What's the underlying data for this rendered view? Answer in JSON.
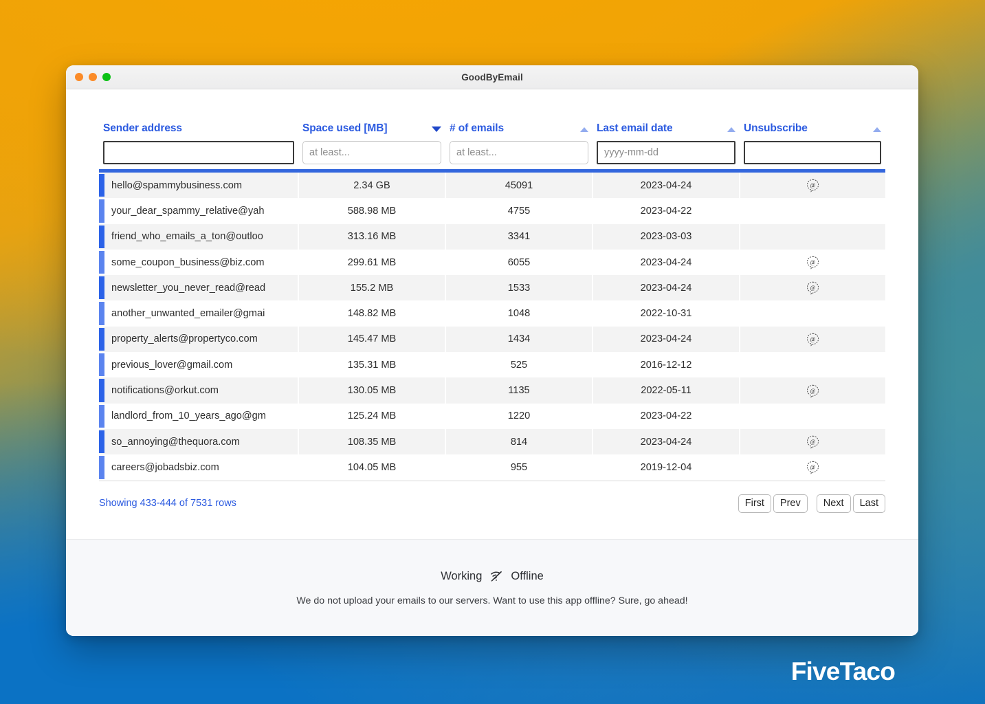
{
  "window": {
    "title": "GoodByEmail",
    "traffic_lights": [
      "close",
      "minimize",
      "maximize"
    ]
  },
  "table": {
    "columns": [
      {
        "label": "Sender address",
        "sort": "none",
        "filter_value": "",
        "filter_placeholder": ""
      },
      {
        "label": "Space used [MB]",
        "sort": "desc",
        "filter_value": "",
        "filter_placeholder": "at least..."
      },
      {
        "label": "# of emails",
        "sort": "asc",
        "filter_value": "",
        "filter_placeholder": "at least..."
      },
      {
        "label": "Last email date",
        "sort": "asc",
        "filter_value": "",
        "filter_placeholder": "yyyy-mm-dd"
      },
      {
        "label": "Unsubscribe",
        "sort": "asc",
        "filter_value": "",
        "filter_placeholder": ""
      }
    ],
    "rows": [
      {
        "sender": "hello@spammybusiness.com",
        "space": "2.34 GB",
        "emails": "45091",
        "date": "2023-04-24",
        "unsubscribe": true,
        "accent": "#2b62e8"
      },
      {
        "sender": "your_dear_spammy_relative@yah",
        "space": "588.98 MB",
        "emails": "4755",
        "date": "2023-04-22",
        "unsubscribe": false,
        "accent": "#5b84ef"
      },
      {
        "sender": "friend_who_emails_a_ton@outloo",
        "space": "313.16 MB",
        "emails": "3341",
        "date": "2023-03-03",
        "unsubscribe": false,
        "accent": "#2b62e8"
      },
      {
        "sender": "some_coupon_business@biz.com",
        "space": "299.61 MB",
        "emails": "6055",
        "date": "2023-04-24",
        "unsubscribe": true,
        "accent": "#5b84ef"
      },
      {
        "sender": "newsletter_you_never_read@read",
        "space": "155.2 MB",
        "emails": "1533",
        "date": "2023-04-24",
        "unsubscribe": true,
        "accent": "#2b62e8"
      },
      {
        "sender": "another_unwanted_emailer@gmai",
        "space": "148.82 MB",
        "emails": "1048",
        "date": "2022-10-31",
        "unsubscribe": false,
        "accent": "#5b84ef"
      },
      {
        "sender": "property_alerts@propertyco.com",
        "space": "145.47 MB",
        "emails": "1434",
        "date": "2023-04-24",
        "unsubscribe": true,
        "accent": "#2b62e8"
      },
      {
        "sender": "previous_lover@gmail.com",
        "space": "135.31 MB",
        "emails": "525",
        "date": "2016-12-12",
        "unsubscribe": false,
        "accent": "#5b84ef"
      },
      {
        "sender": "notifications@orkut.com",
        "space": "130.05 MB",
        "emails": "1135",
        "date": "2022-05-11",
        "unsubscribe": true,
        "accent": "#2b62e8"
      },
      {
        "sender": "landlord_from_10_years_ago@gm",
        "space": "125.24 MB",
        "emails": "1220",
        "date": "2023-04-22",
        "unsubscribe": false,
        "accent": "#5b84ef"
      },
      {
        "sender": "so_annoying@thequora.com",
        "space": "108.35 MB",
        "emails": "814",
        "date": "2023-04-24",
        "unsubscribe": true,
        "accent": "#2b62e8"
      },
      {
        "sender": "careers@jobadsbiz.com",
        "space": "104.05 MB",
        "emails": "955",
        "date": "2019-12-04",
        "unsubscribe": true,
        "accent": "#5b84ef"
      }
    ]
  },
  "pagination": {
    "showing": "Showing 433-444 of 7531 rows",
    "first": "First",
    "prev": "Prev",
    "next": "Next",
    "last": "Last"
  },
  "footer": {
    "working_label": "Working",
    "offline_label": "Offline",
    "note": "We do not upload your emails to our servers. Want to use this app offline? Sure, go ahead!"
  },
  "brand": {
    "name": "FiveTaco"
  },
  "colors": {
    "accent_blue": "#2b5ae0",
    "header_bar": "#3366dd",
    "sort_active": "#1e47c9",
    "sort_inactive": "#93acef"
  }
}
